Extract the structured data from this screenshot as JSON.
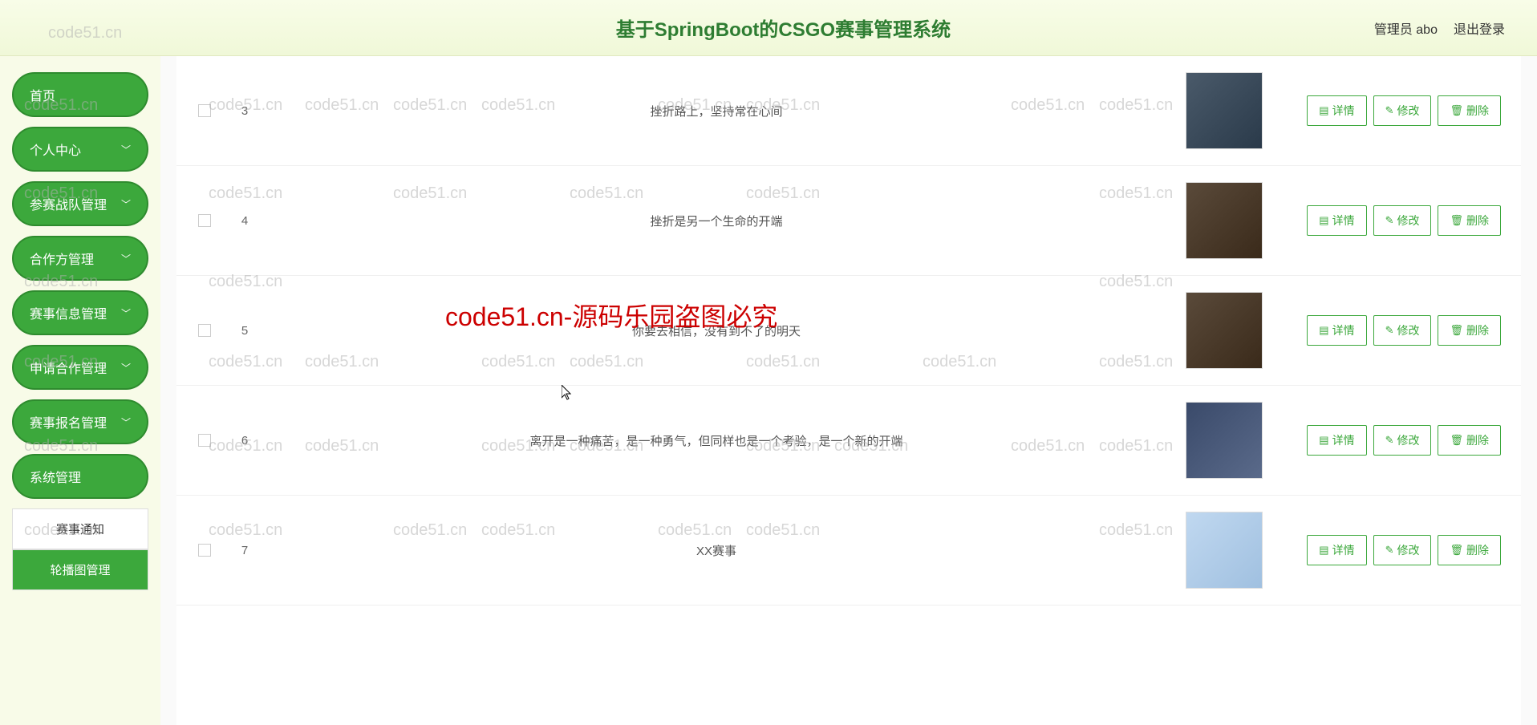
{
  "header": {
    "title": "基于SpringBoot的CSGO赛事管理系统",
    "admin_label": "管理员 abo",
    "logout_label": "退出登录"
  },
  "sidebar": {
    "items": [
      {
        "label": "首页",
        "has_arrow": false
      },
      {
        "label": "个人中心",
        "has_arrow": true
      },
      {
        "label": "参赛战队管理",
        "has_arrow": true
      },
      {
        "label": "合作方管理",
        "has_arrow": true
      },
      {
        "label": "赛事信息管理",
        "has_arrow": true
      },
      {
        "label": "申请合作管理",
        "has_arrow": true
      },
      {
        "label": "赛事报名管理",
        "has_arrow": true
      },
      {
        "label": "系统管理",
        "has_arrow": false
      }
    ],
    "submenu": [
      {
        "label": "赛事通知",
        "active": false
      },
      {
        "label": "轮播图管理",
        "active": true
      }
    ]
  },
  "table": {
    "rows": [
      {
        "index": "3",
        "title": "挫折路上，坚持常在心间"
      },
      {
        "index": "4",
        "title": "挫折是另一个生命的开端"
      },
      {
        "index": "5",
        "title": "你要去相信，没有到不了的明天"
      },
      {
        "index": "6",
        "title": "离开是一种痛苦，是一种勇气，但同样也是一个考验，是一个新的开端"
      },
      {
        "index": "7",
        "title": "XX赛事"
      }
    ]
  },
  "actions": {
    "detail": "详情",
    "edit": "修改",
    "delete": "删除"
  },
  "watermark": {
    "text": "code51.cn",
    "red_text": "code51.cn-源码乐园盗图必究"
  }
}
